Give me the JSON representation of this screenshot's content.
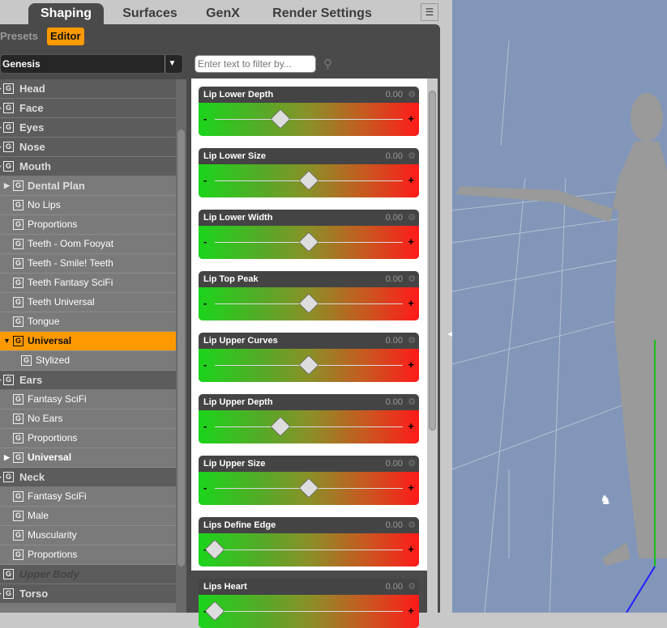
{
  "tabs": [
    "Shaping",
    "Surfaces",
    "GenX",
    "Render Settings"
  ],
  "subtabs": {
    "presets": "Presets",
    "editor": "Editor"
  },
  "figure_select": "Genesis",
  "filter_placeholder": "Enter text to filter by...",
  "tree": [
    {
      "label": "Head",
      "type": "cat"
    },
    {
      "label": "Face",
      "type": "cat"
    },
    {
      "label": "Eyes",
      "type": "cat"
    },
    {
      "label": "Nose",
      "type": "cat"
    },
    {
      "label": "Mouth",
      "type": "cat"
    },
    {
      "label": "Dental Plan",
      "type": "childexp"
    },
    {
      "label": "No Lips",
      "type": "child"
    },
    {
      "label": "Proportions",
      "type": "child"
    },
    {
      "label": "Teeth - Oom Fooyat",
      "type": "child"
    },
    {
      "label": "Teeth - Smile! Teeth",
      "type": "child"
    },
    {
      "label": "Teeth Fantasy SciFi",
      "type": "child"
    },
    {
      "label": "Teeth Universal",
      "type": "child"
    },
    {
      "label": "Tongue",
      "type": "child"
    },
    {
      "label": "Universal",
      "type": "sel"
    },
    {
      "label": "Stylized",
      "type": "grand"
    },
    {
      "label": "Ears",
      "type": "cat"
    },
    {
      "label": "Fantasy SciFi",
      "type": "child"
    },
    {
      "label": "No Ears",
      "type": "child"
    },
    {
      "label": "Proportions",
      "type": "child"
    },
    {
      "label": "Universal",
      "type": "childexpb"
    },
    {
      "label": "Neck",
      "type": "cat"
    },
    {
      "label": "Fantasy SciFi",
      "type": "child"
    },
    {
      "label": "Male",
      "type": "child"
    },
    {
      "label": "Muscularity",
      "type": "child"
    },
    {
      "label": "Proportions",
      "type": "child"
    },
    {
      "label": "Upper Body",
      "type": "dim"
    },
    {
      "label": "Torso",
      "type": "cat"
    }
  ],
  "sliders": [
    {
      "label": "Lip Lower Depth",
      "value": "0.00",
      "pos": 0.35
    },
    {
      "label": "Lip Lower Size",
      "value": "0.00",
      "pos": 0.5
    },
    {
      "label": "Lip Lower Width",
      "value": "0.00",
      "pos": 0.5
    },
    {
      "label": "Lip Top Peak",
      "value": "0.00",
      "pos": 0.5
    },
    {
      "label": "Lip Upper Curves",
      "value": "0.00",
      "pos": 0.5
    },
    {
      "label": "Lip Upper Depth",
      "value": "0.00",
      "pos": 0.35
    },
    {
      "label": "Lip Upper Size",
      "value": "0.00",
      "pos": 0.5
    },
    {
      "label": "Lips Define Edge",
      "value": "0.00",
      "pos": 0.0
    },
    {
      "label": "Lips Heart",
      "value": "0.00",
      "pos": 0.0
    }
  ]
}
